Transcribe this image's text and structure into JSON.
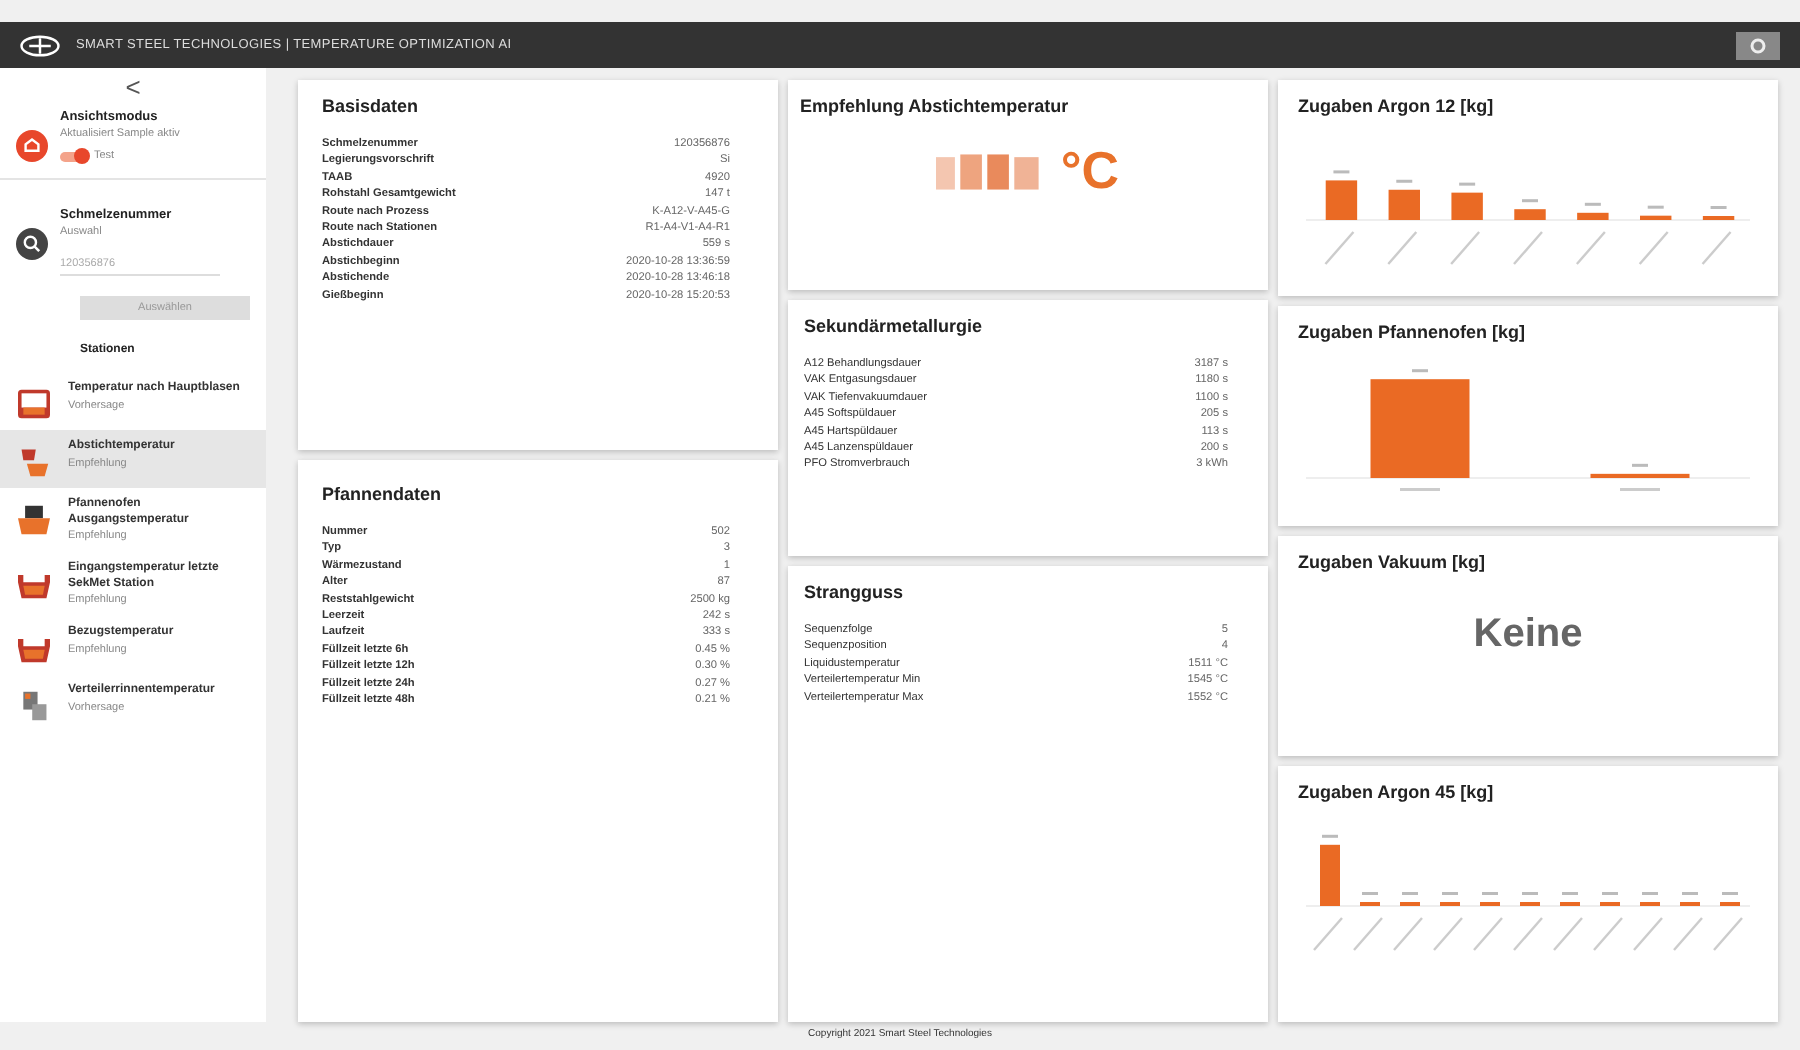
{
  "header": {
    "title": "SMART STEEL TECHNOLOGIES | TEMPERATURE OPTIMIZATION AI"
  },
  "sidebar": {
    "back": "<",
    "mode": {
      "title": "Ansichtsmodus",
      "subtitle": "Aktualisiert Sample aktiv",
      "toggle_label": "Test",
      "on": true
    },
    "heat": {
      "title": "Schmelzenummer",
      "subtitle": "Auswahl",
      "placeholder": "120356876",
      "button": "Auswählen",
      "button_disabled": true
    },
    "stations_title": "Stationen",
    "stations": [
      {
        "name": "Temperatur nach Hauptblasen",
        "sub": "Vorhersage",
        "kind": "converter",
        "selected": false
      },
      {
        "name": "Abstichtemperatur",
        "sub": "Empfehlung",
        "kind": "tapping",
        "selected": true
      },
      {
        "name": "Pfannenofen Ausgangstemperatur",
        "sub": "Empfehlung",
        "kind": "furnace",
        "selected": false
      },
      {
        "name": "Eingangstemperatur letzte SekMet Station",
        "sub": "Empfehlung",
        "kind": "ladle",
        "selected": false
      },
      {
        "name": "Bezugstemperatur",
        "sub": "Empfehlung",
        "kind": "ladle",
        "selected": false
      },
      {
        "name": "Verteilerrinnentemperatur",
        "sub": "Vorhersage",
        "kind": "tundish",
        "selected": false
      }
    ]
  },
  "basisdaten": {
    "title": "Basisdaten",
    "rows": [
      {
        "label": "Schmelzenummer",
        "value": "120356876"
      },
      {
        "label": "Legierungsvorschrift",
        "value": "Si"
      },
      {
        "label": "TAAB",
        "value": "4920"
      },
      {
        "label": "Rohstahl Gesamtgewicht",
        "value": "147 t"
      },
      {
        "label": "Route nach Prozess",
        "value": "K-A12-V-A45-G"
      },
      {
        "label": "Route nach Stationen",
        "value": "R1-A4-V1-A4-R1"
      },
      {
        "label": "Abstichdauer",
        "value": "559 s"
      },
      {
        "label": "Abstichbeginn",
        "value": "2020-10-28 13:36:59"
      },
      {
        "label": "Abstichende",
        "value": "2020-10-28 13:46:18"
      },
      {
        "label": "Gießbeginn",
        "value": "2020-10-28 15:20:53"
      }
    ]
  },
  "pfannendaten": {
    "title": "Pfannendaten",
    "rows": [
      {
        "label": "Nummer",
        "value": "502"
      },
      {
        "label": "Typ",
        "value": "3"
      },
      {
        "label": "Wärmezustand",
        "value": "1"
      },
      {
        "label": "Alter",
        "value": "87"
      },
      {
        "label": "Reststahlgewicht",
        "value": "2500 kg"
      },
      {
        "label": "Leerzeit",
        "value": "242 s"
      },
      {
        "label": "Laufzeit",
        "value": "333 s"
      },
      {
        "label": "Füllzeit letzte 6h",
        "value": "0.45 %"
      },
      {
        "label": "Füllzeit letzte 12h",
        "value": "0.30 %"
      },
      {
        "label": "Füllzeit letzte 24h",
        "value": "0.27 %"
      },
      {
        "label": "Füllzeit letzte 48h",
        "value": "0.21 %"
      }
    ]
  },
  "empfehlung": {
    "title": "Empfehlung Abstichtemperatur",
    "unit": "°C"
  },
  "sekundaermetallurgie": {
    "title": "Sekundärmetallurgie",
    "rows": [
      {
        "label": "A12 Behandlungsdauer",
        "value": "3187 s"
      },
      {
        "label": "VAK Entgasungsdauer",
        "value": "1180 s"
      },
      {
        "label": "VAK Tiefenvakuumdauer",
        "value": "1100 s"
      },
      {
        "label": "A45 Softspüldauer",
        "value": "205 s"
      },
      {
        "label": "A45 Hartspüldauer",
        "value": "113 s"
      },
      {
        "label": "A45 Lanzenspüldauer",
        "value": "200 s"
      },
      {
        "label": "PFO Stromverbrauch",
        "value": "3 kWh"
      }
    ]
  },
  "strangguss": {
    "title": "Strangguss",
    "rows": [
      {
        "label": "Sequenzfolge",
        "value": "5"
      },
      {
        "label": "Sequenzposition",
        "value": "4"
      },
      {
        "label": "Liquidustemperatur",
        "value": "1511 °C"
      },
      {
        "label": "Verteilertemperatur Min",
        "value": "1545 °C"
      },
      {
        "label": "Verteilertemperatur Max",
        "value": "1552 °C"
      }
    ]
  },
  "charts": [
    {
      "title": "Zugaben Argon 12 [kg]",
      "kind": "picture"
    },
    {
      "title": "Zugaben Pfannenofen [kg]",
      "kind": "picture"
    },
    {
      "title": "Zugaben Vakuum [kg]",
      "empty_text": "Keine"
    },
    {
      "title": "Zugaben Argon 45 [kg]",
      "kind": "picture"
    }
  ],
  "footer": {
    "text": "Copyright 2021 Smart Steel Technologies"
  }
}
